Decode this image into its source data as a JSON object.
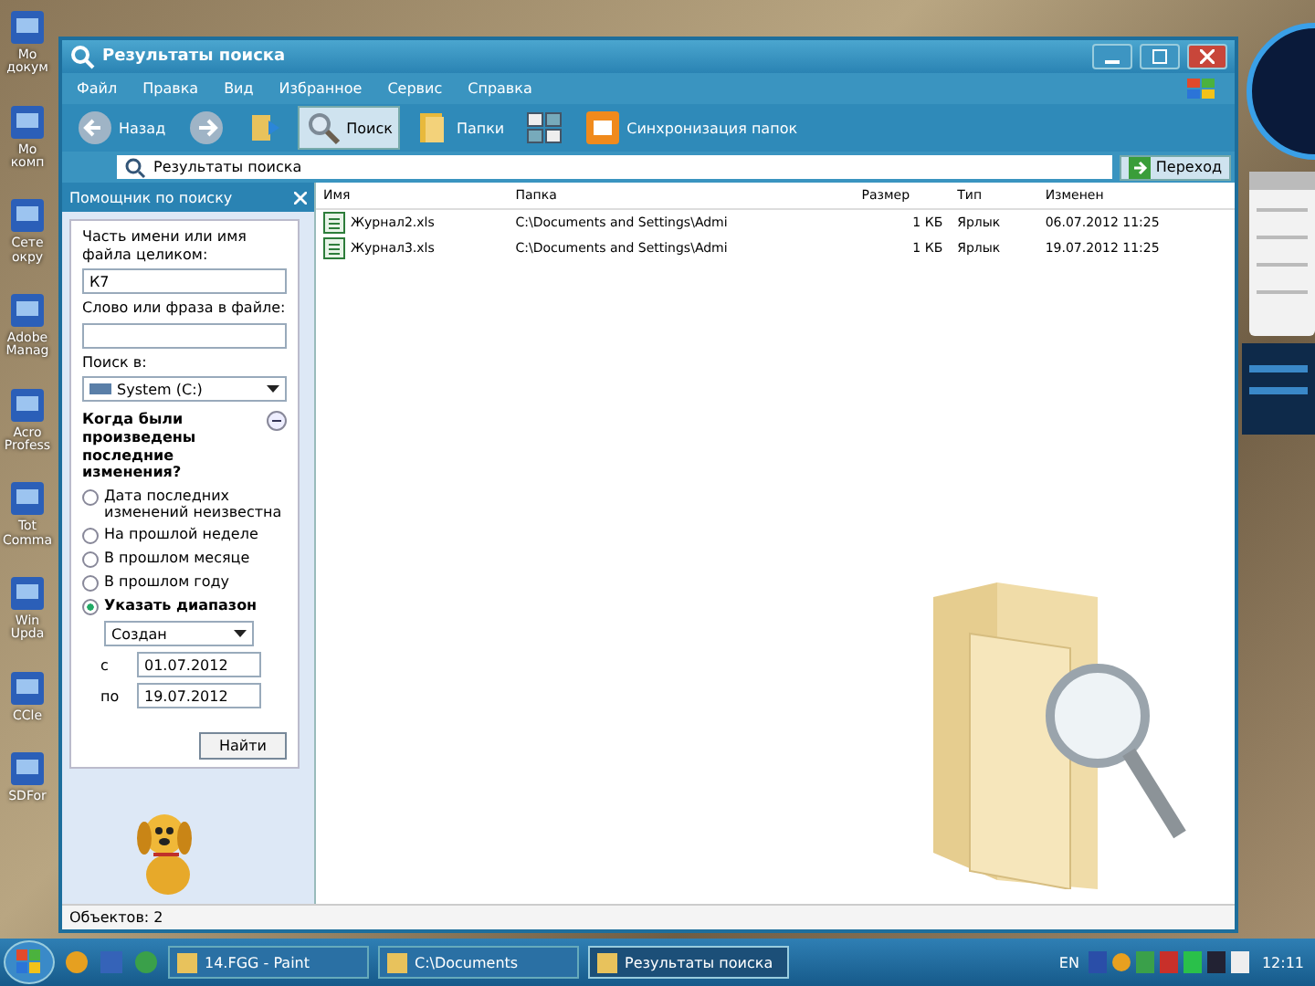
{
  "desktop_icons": [
    {
      "label": "Мо докум"
    },
    {
      "label": "Мо комп"
    },
    {
      "label": "Сете окру"
    },
    {
      "label": "Adobe Manag"
    },
    {
      "label": "Acro Profess"
    },
    {
      "label": "Tot Comma"
    },
    {
      "label": "Win Upda"
    },
    {
      "label": "CCle"
    },
    {
      "label": "SDFor"
    }
  ],
  "window": {
    "title": "Результаты поиска"
  },
  "menu": [
    "Файл",
    "Правка",
    "Вид",
    "Избранное",
    "Сервис",
    "Справка"
  ],
  "toolbar": [
    {
      "kind": "back",
      "label": "Назад",
      "selected": false
    },
    {
      "kind": "forward",
      "selected": false
    },
    {
      "kind": "up",
      "selected": false
    },
    {
      "kind": "search",
      "label": "Поиск",
      "selected": true
    },
    {
      "kind": "folders",
      "label": "Папки",
      "selected": false
    },
    {
      "kind": "views",
      "selected": false
    },
    {
      "kind": "sync",
      "label": "Синхронизация папок",
      "selected": false
    }
  ],
  "address": {
    "value": "Результаты поиска",
    "go": "Переход"
  },
  "search_pane": {
    "title": "Помощник по поиску",
    "name_label": "Часть имени или имя файла целиком:",
    "name_value": "К7",
    "phrase_label": "Слово или фраза в файле:",
    "look_in_label": "Поиск в:",
    "look_in": "System (C:)",
    "when_label": "Когда были произведены последние изменения?",
    "options": [
      {
        "label": "Дата последних изменений неизвестна",
        "selected": false
      },
      {
        "label": "На прошлой неделе",
        "selected": false
      },
      {
        "label": "В прошлом месяце",
        "selected": false
      },
      {
        "label": "В прошлом году",
        "selected": false
      },
      {
        "label": "Указать диапазон",
        "selected": true
      }
    ],
    "date_kind": "Создан",
    "from_label": "с",
    "from": "01.07.2012",
    "to_label": "по",
    "to": "19.07.2012",
    "find": "Найти"
  },
  "table": {
    "columns": [
      "Имя",
      "Папка",
      "Размер",
      "Тип",
      "Изменен"
    ],
    "rows": [
      [
        "Журнал2.xls",
        "C:\\Documents and Settings\\Admi",
        "1 КБ",
        "Ярлык",
        "06.07.2012 11:25"
      ],
      [
        "Журнал3.xls",
        "C:\\Documents and Settings\\Admi",
        "1 КБ",
        "Ярлык",
        "19.07.2012 11:25"
      ]
    ]
  },
  "status_bar": "Объектов: 2",
  "taskbar": {
    "tasks": [
      {
        "label": "14.FGG - Paint",
        "selected": false
      },
      {
        "label": "C:\\Documents",
        "selected": false
      },
      {
        "label": "Результаты поиска",
        "selected": true
      }
    ],
    "lang": "EN",
    "clock": "12:11"
  }
}
